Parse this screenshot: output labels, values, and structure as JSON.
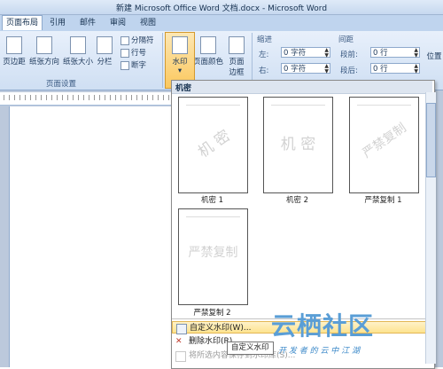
{
  "window": {
    "title": "新建 Microsoft Office Word 文档.docx - Microsoft Word"
  },
  "tabs": [
    "页面布局",
    "引用",
    "邮件",
    "审阅",
    "视图"
  ],
  "ribbon": {
    "page_setup": {
      "margins": "页边距",
      "orientation": "纸张方向",
      "size": "纸张大小",
      "columns": "分栏",
      "breaks": "分隔符",
      "line_numbers": "行号",
      "hyphenation": "断字",
      "group_label": "页面设置"
    },
    "background": {
      "watermark": "水印",
      "page_color": "页面颜色",
      "page_borders_line1": "页面",
      "page_borders_line2": "边框"
    },
    "indent": {
      "label": "缩进",
      "left_label": "左:",
      "left_value": "0 字符",
      "right_label": "右:",
      "right_value": "0 字符"
    },
    "spacing": {
      "label": "间距",
      "before_label": "段前:",
      "before_value": "0 行",
      "after_label": "段后:",
      "after_value": "0 行"
    },
    "position": "位置"
  },
  "watermark_menu": {
    "section": "机密",
    "items": [
      {
        "text": "机 密",
        "label": "机密 1",
        "diag": true
      },
      {
        "text": "机 密",
        "label": "机密 2",
        "diag": false
      },
      {
        "text": "严禁复制",
        "label": "严禁复制 1",
        "diag": true
      },
      {
        "text": "严禁复制",
        "label": "严禁复制 2",
        "diag": false
      }
    ],
    "custom": "自定义水印(W)...",
    "remove": "删除水印(R)",
    "save": "将所选内容保存到水印库(S)..."
  },
  "tooltip": "自定义水印",
  "watermark_overlay": {
    "title": "云栖社区",
    "subtitle": "开 发 者 的 云 中 江 湖"
  }
}
